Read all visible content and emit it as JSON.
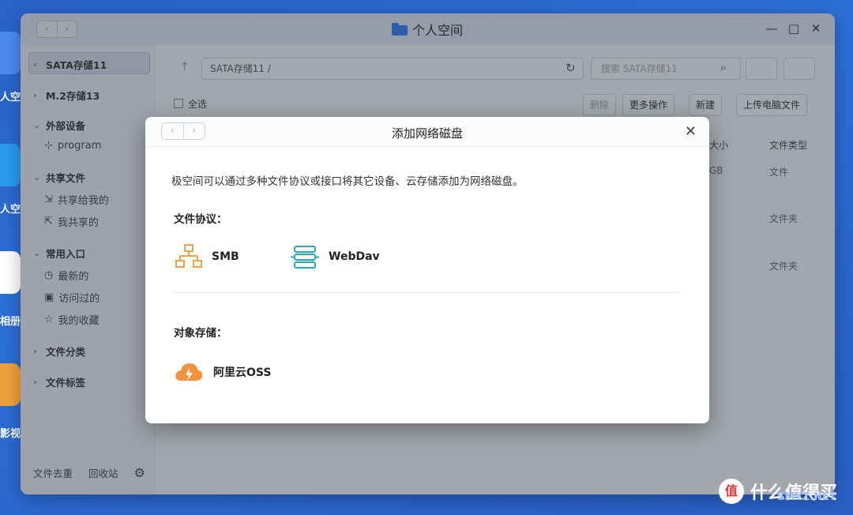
{
  "desktop": {
    "labels": [
      "人空间",
      "人空间",
      "相册",
      "影视"
    ]
  },
  "window": {
    "title": "个人空间",
    "nav_back": "‹",
    "nav_forward": "›",
    "minimize": "—",
    "maximize": "□",
    "close": "✕"
  },
  "sidebar": {
    "items": [
      {
        "label": "SATA存储11"
      },
      {
        "label": "M.2存储13"
      },
      {
        "label": "外部设备"
      },
      {
        "label": "program"
      },
      {
        "label": "共享文件"
      },
      {
        "label": "共享给我的"
      },
      {
        "label": "我共享的"
      },
      {
        "label": "常用入口"
      },
      {
        "label": "最新的"
      },
      {
        "label": "访问过的"
      },
      {
        "label": "我的收藏"
      },
      {
        "label": "文件分类"
      },
      {
        "label": "文件标签"
      }
    ],
    "bottom": {
      "dedupe": "文件去重",
      "recycle": "回收站"
    }
  },
  "content": {
    "path": "SATA存储11 /",
    "search_placeholder": "搜索 SATA存储11",
    "select_all": "全选",
    "delete": "删除",
    "more_actions": "更多操作",
    "new": "新建",
    "upload": "上传电脑文件",
    "columns": {
      "size": "大小",
      "type": "文件类型"
    },
    "rows": [
      {
        "size": "GB",
        "type": "文件"
      },
      {
        "size": "",
        "type": "文件夹"
      },
      {
        "size": "",
        "type": "文件夹"
      }
    ]
  },
  "dialog": {
    "title": "添加网络磁盘",
    "close": "✕",
    "description": "极空间可以通过多种文件协议或接口将其它设备、云存储添加为网络磁盘。",
    "protocols_title": "文件协议：",
    "protocols": [
      {
        "label": "SMB",
        "icon": "network-icon"
      },
      {
        "label": "WebDav",
        "icon": "server-stack-icon"
      }
    ],
    "storage_title": "对象存储：",
    "storage": [
      {
        "label": "阿里云OSS",
        "icon": "cloud-icon"
      }
    ]
  },
  "watermark": {
    "text": "什么值得买",
    "badge": "值",
    "sub": "SMYZ.NET"
  },
  "colors": {
    "accent": "#2d7ff6",
    "smb_orange": "#f5a14a",
    "webdav_teal": "#2aa8b8",
    "oss_orange": "#f4913b"
  }
}
